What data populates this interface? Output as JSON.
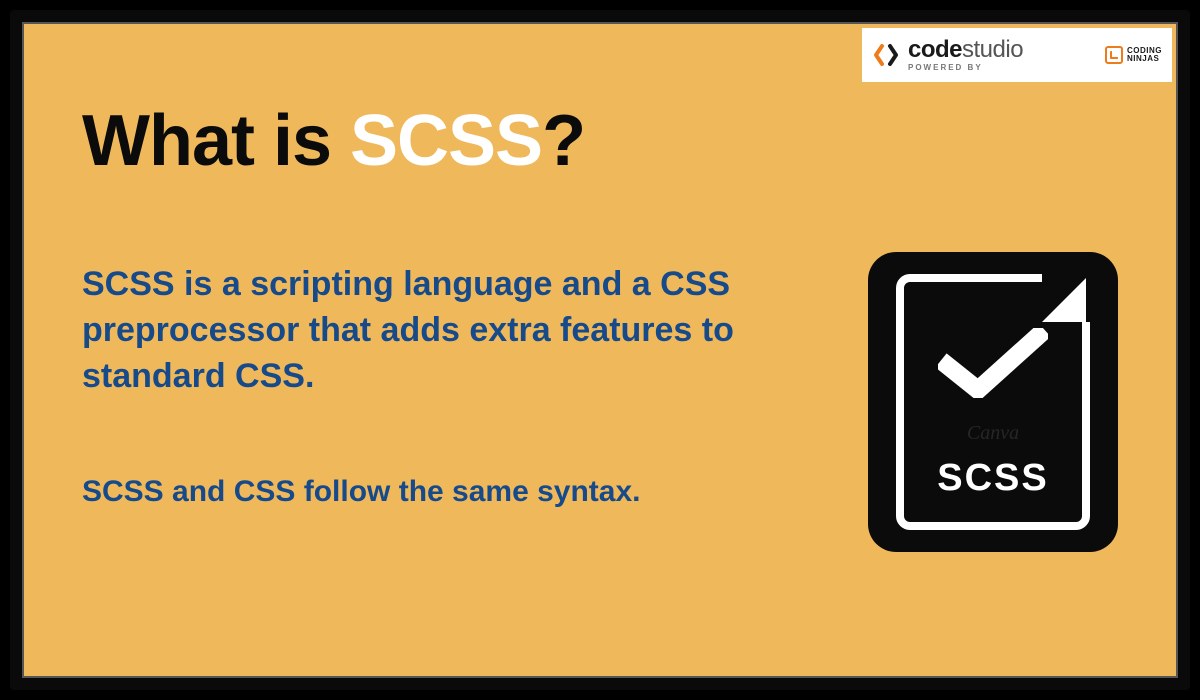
{
  "logo": {
    "mainBold": "code",
    "mainLight": "studio",
    "sub": "POWERED BY",
    "ninjasLine1": "CODING",
    "ninjasLine2": "NINJAS"
  },
  "heading": {
    "part1": "What is ",
    "highlight": "SCSS",
    "part2": "?"
  },
  "body": {
    "p1": "SCSS is a scripting language and a CSS preprocessor that adds extra features to standard CSS.",
    "p2": "SCSS and CSS follow the same syntax."
  },
  "iconLabel": "SCSS",
  "watermark": "Canva"
}
